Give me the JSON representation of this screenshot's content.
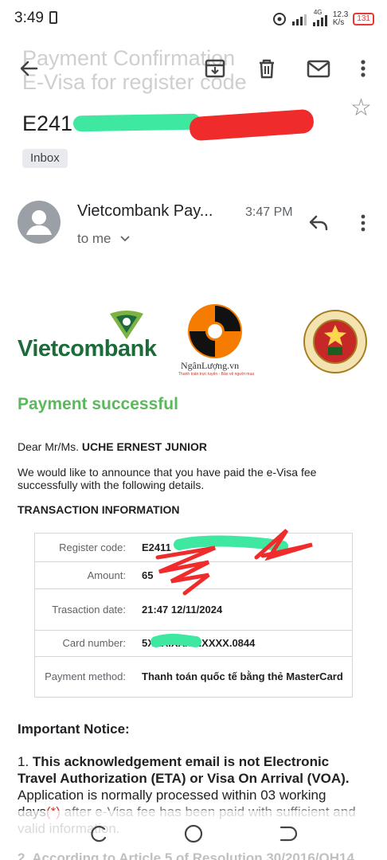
{
  "status_bar": {
    "time": "3:49",
    "network": "4G",
    "speed_value": "12.3",
    "speed_unit": "K/s",
    "battery": "131"
  },
  "toolbar": {
    "back_icon": "arrow-left-icon",
    "archive_icon": "archive-icon",
    "delete_icon": "trash-icon",
    "mark_icon": "mail-icon",
    "more_icon": "more-vert-icon"
  },
  "email": {
    "ghost_title": "Payment Confirmation\nE-Visa for register code",
    "subject_visible": "E241",
    "label_chip": "Inbox",
    "sender": "Vietcombank Pay...",
    "recipient": "to me",
    "time": "3:47 PM"
  },
  "logos": {
    "vietcombank": "Vietcombank",
    "nganluong": "NgânLượng.vn",
    "nganluong_tagline": "Thanh toán trực tuyến - Bảo vệ người mua",
    "immigration": "QUẢN LÝ XUẤT NHẬP CẢNH IMMIGRATION"
  },
  "body": {
    "heading": "Payment successful",
    "dear_prefix": "Dear Mr/Ms.",
    "name": "UCHE ERNEST JUNIOR",
    "announce": "We would like to announce that you have paid the e-Visa fee successfully with the following details.",
    "transaction_title": "TRANSACTION INFORMATION"
  },
  "transaction": {
    "rows": [
      {
        "label": "Register code:",
        "value": "E2411"
      },
      {
        "label": "Amount:",
        "value": "65"
      },
      {
        "label": "Trasaction date:",
        "value": "21:47 12/11/2024"
      },
      {
        "label": "Card number:",
        "value": "5XXX.XXXX.XXXX.0844"
      },
      {
        "label": "Payment method:",
        "value": "Thanh toán quốc tế bằng thẻ MasterCard"
      }
    ]
  },
  "notice": {
    "heading": "Important Notice:",
    "item1_num": "1.",
    "item1_bold": "This acknowledgement email is not Electronic Travel Authorization (ETA) or Visa On Arrival (VOA).",
    "item1_text": "Application is normally processed within 03 working days",
    "item1_mark": "(*)",
    "item1_rest": "after e-Visa fee has been paid with sufficient and valid information.",
    "item2": "2. According to Article 5 of Resolution 30/2016/QH14"
  },
  "nav": {
    "recents_icon": "recents-icon",
    "home_icon": "home-circle-icon",
    "back_icon": "back-nav-icon"
  }
}
